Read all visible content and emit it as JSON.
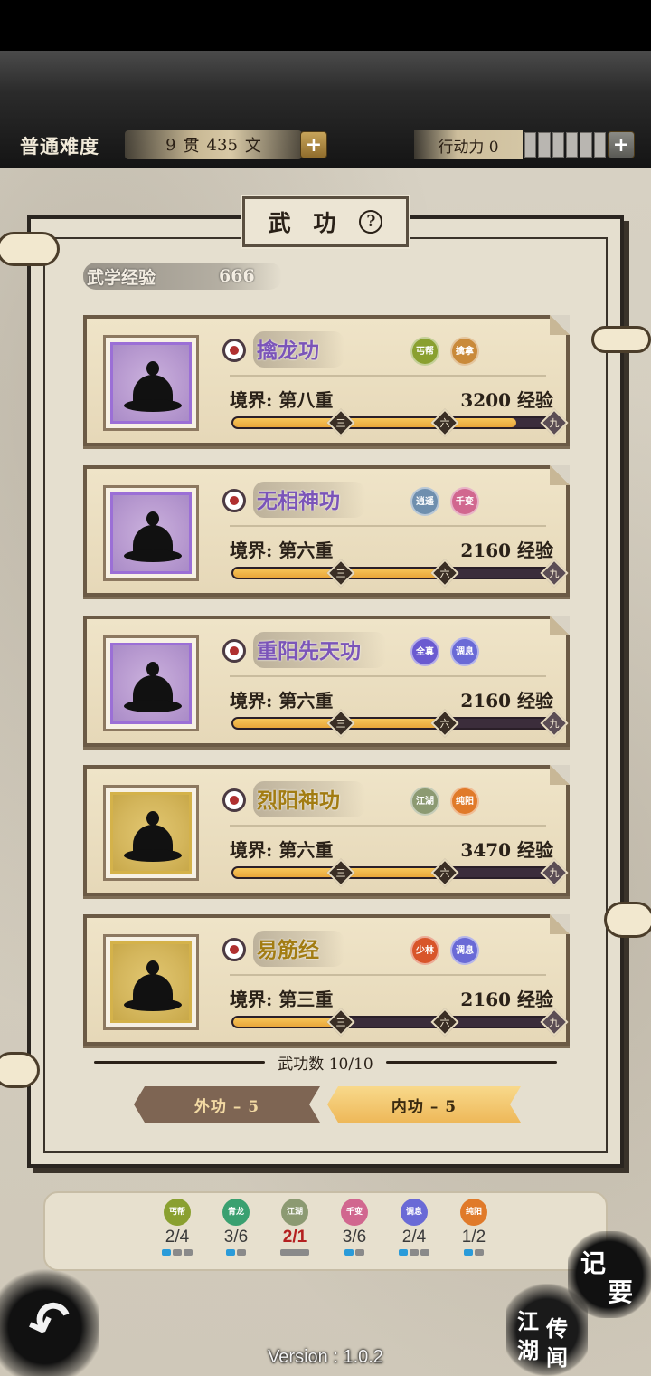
{
  "hud": {
    "difficulty": "普通难度",
    "money_guan": "9",
    "money_guan_unit": "贯",
    "money_wen": "435",
    "money_wen_unit": "文",
    "action_points": "行动力 0",
    "plus": "+"
  },
  "panel": {
    "title": "武 功",
    "help": "?",
    "exp_label": "武学经验",
    "exp_value": "666"
  },
  "skills": [
    {
      "name": "擒龙功",
      "realm": "境界: 第八重",
      "exp": "3200 经验",
      "progress": 0.87,
      "color": "purple",
      "tags": [
        {
          "text": "丐帮",
          "color": "#8aa030"
        },
        {
          "text": "擒拿",
          "color": "#c98a3a"
        }
      ]
    },
    {
      "name": "无相神功",
      "realm": "境界: 第六重",
      "exp": "2160 经验",
      "progress": 0.64,
      "color": "purple",
      "tags": [
        {
          "text": "逍遥",
          "color": "#6f8fae"
        },
        {
          "text": "千变",
          "color": "#d1678f"
        }
      ]
    },
    {
      "name": "重阳先天功",
      "realm": "境界: 第六重",
      "exp": "2160 经验",
      "progress": 0.64,
      "color": "purple",
      "tags": [
        {
          "text": "全真",
          "color": "#6a5ad0"
        },
        {
          "text": "调息",
          "color": "#6a6ad6"
        }
      ]
    },
    {
      "name": "烈阳神功",
      "realm": "境界: 第六重",
      "exp": "3470 经验",
      "progress": 0.64,
      "color": "gold",
      "tags": [
        {
          "text": "江湖",
          "color": "#8c9a72"
        },
        {
          "text": "纯阳",
          "color": "#e07a2a"
        }
      ]
    },
    {
      "name": "易筋经",
      "realm": "境界: 第三重",
      "exp": "2160 经验",
      "progress": 0.32,
      "color": "gold",
      "tags": [
        {
          "text": "少林",
          "color": "#d8552a"
        },
        {
          "text": "调息",
          "color": "#6a6ad6"
        }
      ]
    }
  ],
  "ticks": [
    "三",
    "六",
    "九"
  ],
  "count_label": "武功数 10/10",
  "tabs": {
    "outer": "外功 – 5",
    "inner": "内功 – 5"
  },
  "sects": [
    {
      "name": "丐帮",
      "count": "2/4",
      "color": "#8aa030",
      "pips": [
        true,
        false,
        false
      ],
      "red": false
    },
    {
      "name": "青龙",
      "count": "3/6",
      "color": "#3aa070",
      "pips": [
        true,
        false
      ],
      "red": false
    },
    {
      "name": "江湖",
      "count": "2/1",
      "color": "#8c9a72",
      "pips": [
        "wide"
      ],
      "red": true
    },
    {
      "name": "千变",
      "count": "3/6",
      "color": "#d1678f",
      "pips": [
        true,
        false
      ],
      "red": false
    },
    {
      "name": "调息",
      "count": "2/4",
      "color": "#6a6ad6",
      "pips": [
        true,
        false,
        false
      ],
      "red": false
    },
    {
      "name": "纯阳",
      "count": "1/2",
      "color": "#e07a2a",
      "pips": [
        true,
        false
      ],
      "red": false
    }
  ],
  "corner": {
    "jiyao_1": "记",
    "jiyao_2": "要",
    "jianghu_1": "江",
    "jianghu_2": "湖",
    "jianghu_3": "传",
    "jianghu_4": "闻",
    "back": "↶"
  },
  "version": "Version : 1.0.2"
}
